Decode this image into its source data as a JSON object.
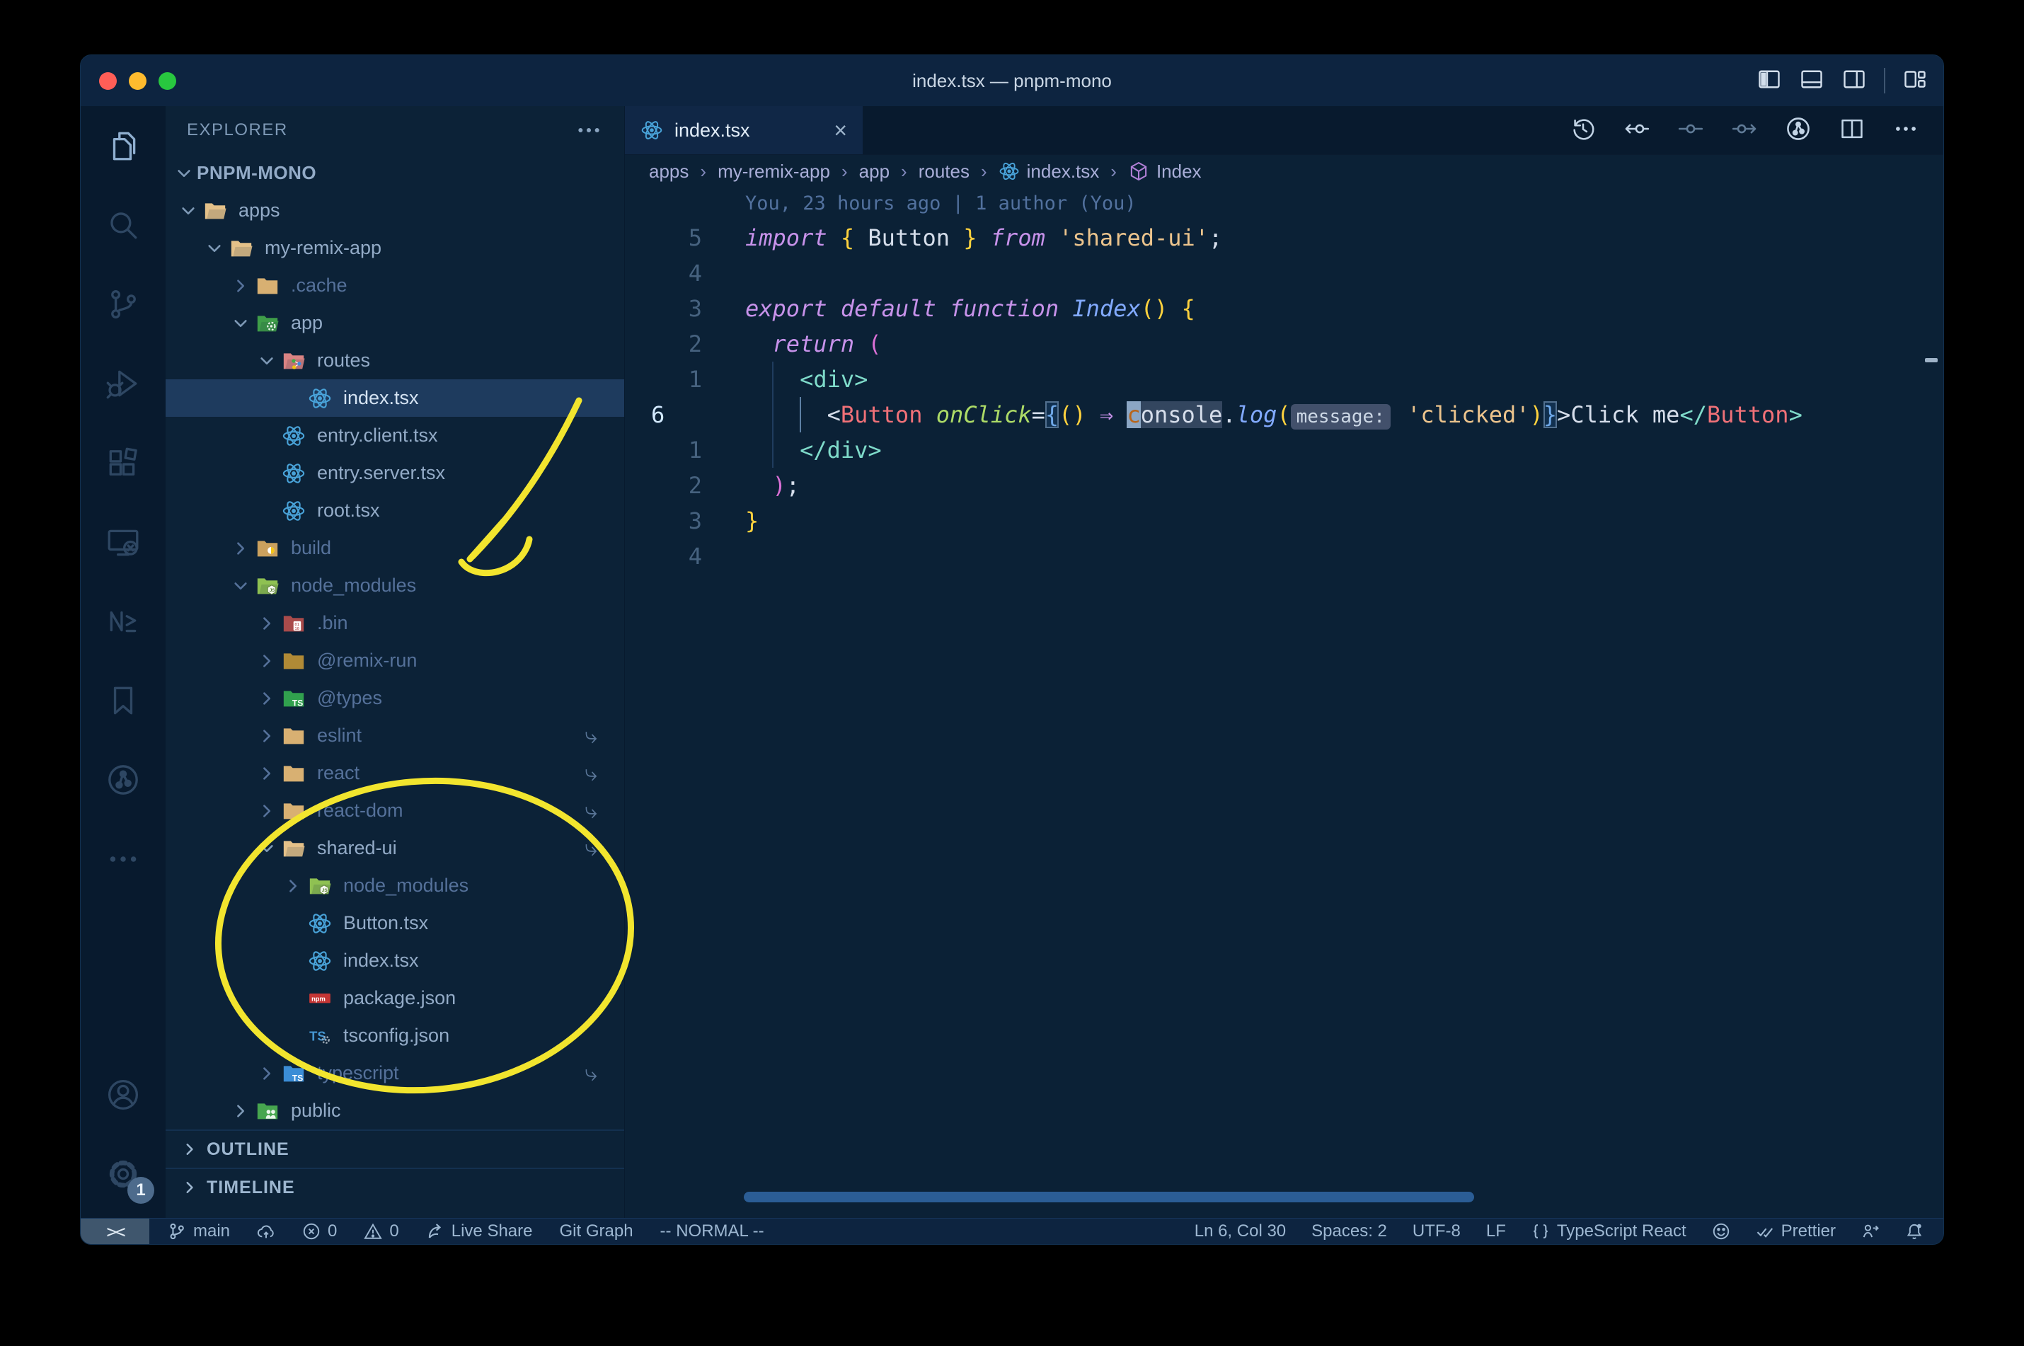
{
  "colors": {
    "annotation_yellow": "#f2e52e",
    "traffic_close": "#ff5e57",
    "traffic_minimize": "#febb2e",
    "traffic_zoom": "#28c73f",
    "accent_selection": "#1e3b5e",
    "statusbar_remote_bg": "#3f566d",
    "react_blue": "#49a3d9",
    "npm_red": "#c53635",
    "ts_blue": "#4596d1",
    "breadcrumb_symbol_purple": "#b180d7"
  },
  "window": {
    "title": "index.tsx — pnpm-mono"
  },
  "titlebar": {
    "controls": [
      {
        "icon": "layout-sidebar-icon"
      },
      {
        "icon": "layout-panel-icon"
      },
      {
        "icon": "layout-sidebar-right-icon"
      },
      {
        "sep": true
      },
      {
        "icon": "layout-customize-icon"
      }
    ]
  },
  "activity_bar": {
    "top": [
      {
        "icon": "explorer-icon",
        "active": true
      },
      {
        "icon": "search-icon"
      },
      {
        "icon": "source-control-icon"
      },
      {
        "icon": "run-debug-icon"
      },
      {
        "icon": "extensions-icon"
      },
      {
        "icon": "remote-explorer-icon"
      },
      {
        "icon": "nx-console-icon"
      },
      {
        "icon": "bookmarks-icon"
      },
      {
        "icon": "git-graph-icon"
      },
      {
        "icon": "more-icon"
      }
    ],
    "bottom": [
      {
        "icon": "account-icon"
      },
      {
        "icon": "settings-gear-icon",
        "badge": "1"
      }
    ]
  },
  "sidebar": {
    "header": "EXPLORER",
    "project": "PNPM-MONO",
    "sections": [
      "OUTLINE",
      "TIMELINE"
    ],
    "tree": [
      {
        "label": "apps",
        "icon": "folder-open-tan-icon",
        "state": "open",
        "depth": 0
      },
      {
        "label": "my-remix-app",
        "icon": "folder-open-tan-icon",
        "state": "open",
        "depth": 1
      },
      {
        "label": ".cache",
        "icon": "folder-tan-icon",
        "state": "closed",
        "depth": 2,
        "dim": true
      },
      {
        "label": "app",
        "icon": "folder-app-icon",
        "state": "open",
        "depth": 2
      },
      {
        "label": "routes",
        "icon": "folder-routes-icon",
        "state": "open",
        "depth": 3
      },
      {
        "label": "index.tsx",
        "icon": "react-icon",
        "state": "file",
        "depth": 4,
        "selected": true
      },
      {
        "label": "entry.client.tsx",
        "icon": "react-icon",
        "state": "file",
        "depth": 3
      },
      {
        "label": "entry.server.tsx",
        "icon": "react-icon",
        "state": "file",
        "depth": 3
      },
      {
        "label": "root.tsx",
        "icon": "react-icon",
        "state": "file",
        "depth": 3
      },
      {
        "label": "build",
        "icon": "folder-dist-icon",
        "state": "closed",
        "depth": 2,
        "dim": true
      },
      {
        "label": "node_modules",
        "icon": "folder-js-icon",
        "state": "open",
        "depth": 2,
        "dim": true
      },
      {
        "label": ".bin",
        "icon": "folder-bin-icon",
        "state": "closed",
        "depth": 3,
        "dim": true
      },
      {
        "label": "@remix-run",
        "icon": "folder-gold-icon",
        "state": "closed",
        "depth": 3,
        "dim": true
      },
      {
        "label": "@types",
        "icon": "folder-ts-green-icon",
        "state": "closed",
        "depth": 3,
        "dim": true
      },
      {
        "label": "eslint",
        "icon": "folder-tan-icon",
        "state": "closed",
        "depth": 3,
        "dim": true,
        "symlink": true
      },
      {
        "label": "react",
        "icon": "folder-tan-icon",
        "state": "closed",
        "depth": 3,
        "dim": true,
        "symlink": true
      },
      {
        "label": "react-dom",
        "icon": "folder-tan-icon",
        "state": "closed",
        "depth": 3,
        "dim": true,
        "symlink": true
      },
      {
        "label": "shared-ui",
        "icon": "folder-open-tan-icon",
        "state": "open",
        "depth": 3,
        "symlink": true
      },
      {
        "label": "node_modules",
        "icon": "folder-js-icon",
        "state": "closed",
        "depth": 4,
        "dim": true
      },
      {
        "label": "Button.tsx",
        "icon": "react-icon",
        "state": "file",
        "depth": 4
      },
      {
        "label": "index.tsx",
        "icon": "react-icon",
        "state": "file",
        "depth": 4
      },
      {
        "label": "package.json",
        "icon": "npm-icon",
        "state": "file",
        "depth": 4
      },
      {
        "label": "tsconfig.json",
        "icon": "tsconfig-icon",
        "state": "file",
        "depth": 4
      },
      {
        "label": "typescript",
        "icon": "folder-ts-blue-icon",
        "state": "closed",
        "depth": 3,
        "dim": true,
        "symlink": true
      },
      {
        "label": "public",
        "icon": "folder-public-icon",
        "state": "closed",
        "depth": 2
      }
    ]
  },
  "tab": {
    "label": "index.tsx",
    "icon": "react-icon",
    "close_glyph": "×"
  },
  "editor_actions": [
    {
      "icon": "history-icon"
    },
    {
      "icon": "prev-change-icon"
    },
    {
      "icon": "commit-icon",
      "dim": true
    },
    {
      "icon": "next-change-icon",
      "dim": true
    },
    {
      "icon": "git-graph-icon"
    },
    {
      "icon": "split-editor-icon"
    },
    {
      "icon": "more-icon"
    }
  ],
  "breadcrumbs": [
    {
      "label": "apps"
    },
    {
      "label": "my-remix-app"
    },
    {
      "label": "app"
    },
    {
      "label": "routes"
    },
    {
      "label": "index.tsx",
      "icon": "react-icon"
    },
    {
      "label": "Index",
      "icon": "symbol-module-icon"
    }
  ],
  "editor": {
    "blame": "You, 23 hours ago | 1 author (You)",
    "lines": [
      {
        "num": "5",
        "tokens": [
          [
            "import ",
            "kw"
          ],
          [
            "{ ",
            "b1"
          ],
          [
            "Button",
            "fg"
          ],
          [
            " } ",
            "b1"
          ],
          [
            "from ",
            "kw"
          ],
          [
            "'shared-ui'",
            "str"
          ],
          [
            ";",
            "fg"
          ]
        ]
      },
      {
        "num": "4",
        "tokens": []
      },
      {
        "num": "3",
        "tokens": [
          [
            "export ",
            "kw"
          ],
          [
            "default ",
            "kw"
          ],
          [
            "function ",
            "kw"
          ],
          [
            "Index",
            "fn"
          ],
          [
            "()",
            "b1"
          ],
          [
            " ",
            "fg"
          ],
          [
            "{",
            "b1"
          ]
        ]
      },
      {
        "num": "2",
        "tokens": [
          [
            "  ",
            "fg"
          ],
          [
            "return ",
            "kw"
          ],
          [
            "(",
            "b2"
          ]
        ]
      },
      {
        "num": "1",
        "tokens": [
          [
            "    ",
            "fg"
          ],
          [
            "<div>",
            "tag"
          ]
        ]
      },
      {
        "num": "6",
        "current": true,
        "tokens": [
          [
            "      ",
            "fg"
          ],
          [
            "<",
            "fg"
          ],
          [
            "Button",
            "comp"
          ],
          [
            " ",
            "fg"
          ],
          [
            "onClick",
            "attr"
          ],
          [
            "=",
            "fg"
          ],
          [
            "{",
            "b3m"
          ],
          [
            "()",
            "b1"
          ],
          [
            " ",
            "fg"
          ],
          [
            "⇒",
            "kw"
          ],
          [
            " ",
            "fg"
          ],
          [
            "c",
            "cur"
          ],
          [
            "onsole",
            "hi"
          ],
          [
            ".",
            "fg"
          ],
          [
            "log",
            "fn"
          ],
          [
            "(",
            "b1"
          ],
          [
            "message:",
            "inlay"
          ],
          [
            " ",
            "fg"
          ],
          [
            "'clicked'",
            "str"
          ],
          [
            ")",
            "b1"
          ],
          [
            "}",
            "b3m"
          ],
          [
            ">",
            "fg"
          ],
          [
            "Click me",
            "fg"
          ],
          [
            "</",
            "tag"
          ],
          [
            "Button",
            "comp"
          ],
          [
            ">",
            "tag"
          ]
        ]
      },
      {
        "num": "1",
        "tokens": [
          [
            "    ",
            "fg"
          ],
          [
            "</div>",
            "tag"
          ]
        ]
      },
      {
        "num": "2",
        "tokens": [
          [
            "  ",
            "fg"
          ],
          [
            ")",
            "b2"
          ],
          [
            ";",
            "fg"
          ]
        ]
      },
      {
        "num": "3",
        "tokens": [
          [
            "}",
            "b1"
          ]
        ]
      },
      {
        "num": "4",
        "tokens": []
      }
    ]
  },
  "status_bar": {
    "remote_indicator": "><",
    "left": [
      {
        "icon": "git-branch-icon",
        "label": "main"
      },
      {
        "icon": "cloud-upload-icon",
        "label": ""
      },
      {
        "icon": "error-icon",
        "label": "0"
      },
      {
        "icon": "warning-icon",
        "label": "0"
      },
      {
        "icon": "live-share-icon",
        "label": "Live Share"
      },
      {
        "label": "Git Graph"
      },
      {
        "label": "-- NORMAL --"
      }
    ],
    "right": [
      {
        "label": "Ln 6, Col 30"
      },
      {
        "label": "Spaces: 2"
      },
      {
        "label": "UTF-8"
      },
      {
        "label": "LF"
      },
      {
        "icon": "braces-icon",
        "label": "TypeScript React"
      },
      {
        "icon": "feedback-smiley-icon",
        "label": ""
      },
      {
        "icon": "double-check-icon",
        "label": "Prettier"
      },
      {
        "icon": "live-share-contact-icon",
        "label": ""
      },
      {
        "icon": "bell-icon",
        "label": ""
      }
    ]
  },
  "annotations": {
    "arrow_meaning": "hand-drawn arrow pointing at node_modules",
    "circle_meaning": "hand-drawn circle around shared-ui package files"
  }
}
